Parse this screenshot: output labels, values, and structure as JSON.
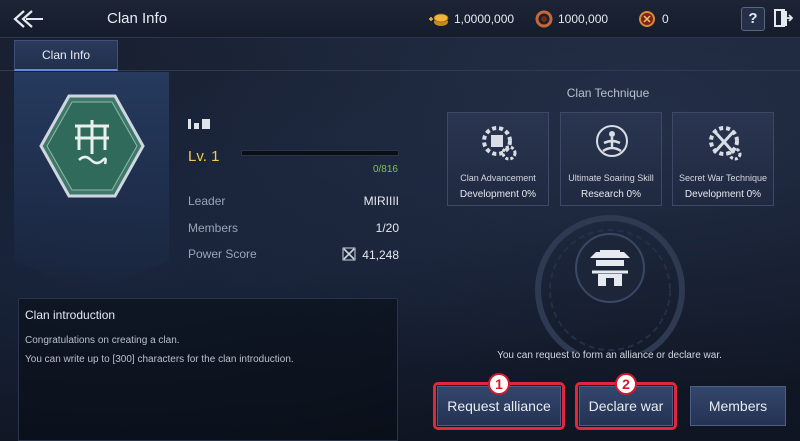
{
  "header": {
    "title": "Clan Info",
    "currencies": [
      {
        "icon": "gold-coins-icon",
        "value": "1,0000,000"
      },
      {
        "icon": "bronze-ring-icon",
        "value": "1000,000"
      },
      {
        "icon": "red-gem-icon",
        "value": "0"
      }
    ],
    "help_label": "?"
  },
  "tabs": [
    {
      "label": "Clan Info"
    }
  ],
  "clan": {
    "level": "Lv. 1",
    "exp_text": "0/816",
    "exp_progress": 0,
    "rows": [
      {
        "label": "Leader",
        "value": "MIRIIII"
      },
      {
        "label": "Members",
        "value": "1/20"
      },
      {
        "label": "Power Score",
        "value": "41,248"
      }
    ]
  },
  "intro": {
    "title": "Clan introduction",
    "lines": [
      "Congratulations on creating a clan.",
      "You can write up to [300] characters for the clan introduction."
    ]
  },
  "technique": {
    "title": "Clan Technique",
    "items": [
      {
        "name": "Clan Advancement",
        "status": "Development 0%",
        "icon": "scroll-gear-icon"
      },
      {
        "name": "Ultimate Soaring Skill",
        "status": "Research 0%",
        "icon": "meditation-icon"
      },
      {
        "name": "Secret War Technique",
        "status": "Development 0%",
        "icon": "sword-gear-icon"
      }
    ]
  },
  "hint": "You can request to form an alliance or declare war.",
  "buttons": {
    "request_alliance": "Request alliance",
    "declare_war": "Declare war",
    "members": "Members"
  },
  "markers": [
    "1",
    "2"
  ],
  "colors": {
    "accent_gold": "#f2c94c",
    "exp_green": "#7bc35a",
    "highlight_red": "#e0283c"
  }
}
